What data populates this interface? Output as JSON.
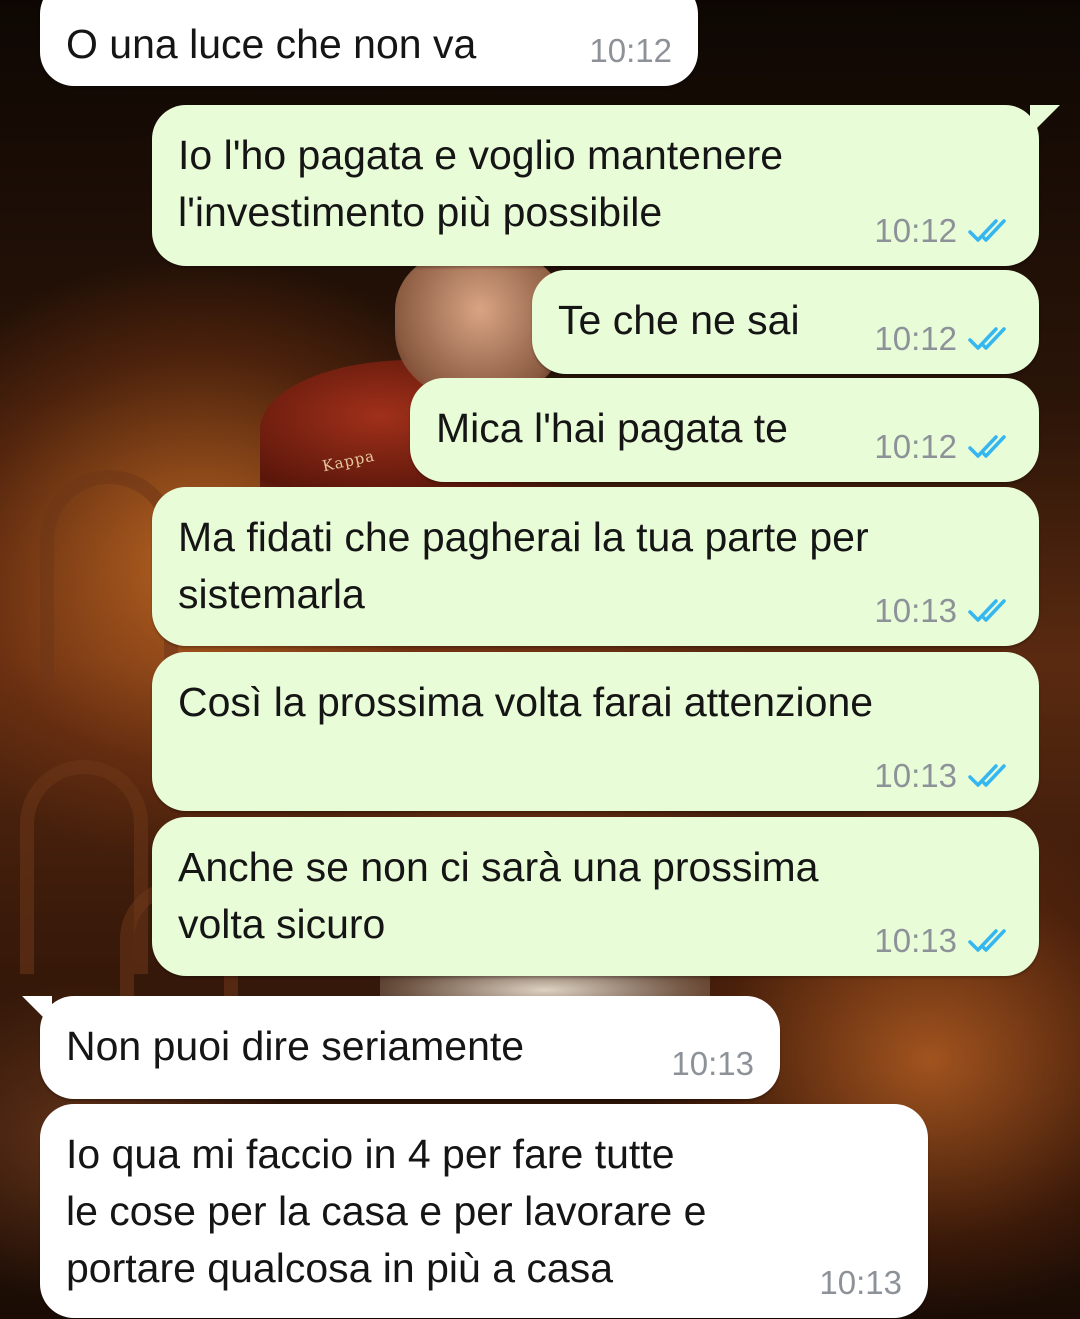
{
  "chat": {
    "messages": [
      {
        "direction": "incoming",
        "text": "O una luce che non va",
        "time": "10:12"
      },
      {
        "direction": "outgoing",
        "text": "Io l'ho pagata e voglio mantenere\nl'investimento più possibile",
        "time": "10:12",
        "status": "read"
      },
      {
        "direction": "outgoing",
        "text": "Te che ne sai",
        "time": "10:12",
        "status": "read"
      },
      {
        "direction": "outgoing",
        "text": "Mica l'hai pagata te",
        "time": "10:12",
        "status": "read"
      },
      {
        "direction": "outgoing",
        "text": "Ma fidati che pagherai la tua parte per\nsistemarla",
        "time": "10:13",
        "status": "read"
      },
      {
        "direction": "outgoing",
        "text": "Così la prossima volta farai attenzione",
        "time": "10:13",
        "status": "read"
      },
      {
        "direction": "outgoing",
        "text": "Anche se non ci sarà una prossima\nvolta sicuro",
        "time": "10:13",
        "status": "read"
      },
      {
        "direction": "incoming",
        "text": "Non puoi dire seriamente",
        "time": "10:13"
      },
      {
        "direction": "incoming",
        "text": "Io qua mi faccio in 4 per fare tutte\nle cose per la casa e per lavorare e\nportare qualcosa in più a casa",
        "time": "10:13"
      }
    ]
  },
  "wallpaper": {
    "logo_text": "Kappa"
  },
  "colors": {
    "incoming_bubble": "#ffffff",
    "outgoing_bubble": "#e8fcd7",
    "timestamp": "#8d9299",
    "read_ticks": "#34b7f1"
  },
  "icons": {
    "read_receipt": "double-check-icon"
  }
}
